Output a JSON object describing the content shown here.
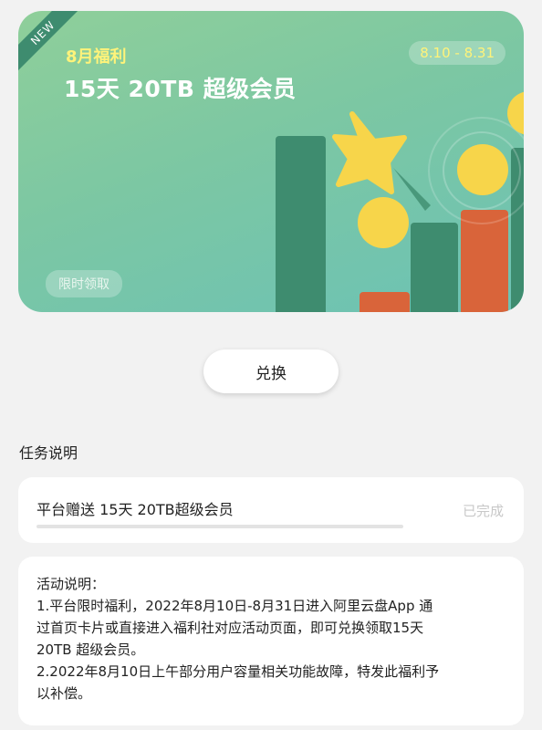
{
  "banner": {
    "ribbon_label": "NEW",
    "subtitle": "8月福利",
    "title": "15天 20TB 超级会员",
    "date_range": "8.10 - 8.31",
    "limited_label": "限时领取"
  },
  "redeem_button": {
    "label": "兑换"
  },
  "task_section": {
    "title": "任务说明",
    "task": {
      "label": "平台赠送 15天 20TB超级会员",
      "status": "已完成",
      "progress": 1.0
    }
  },
  "description": {
    "lines": [
      "活动说明：",
      "1.平台限时福利，2022年8月10日-8月31日进入阿里云盘App 通",
      "过首页卡片或直接进入福利社对应活动页面，即可兑换领取15天",
      "20TB 超级会员。",
      "2.2022年8月10日上午部分用户容量相关功能故障，特发此福利予",
      "以补偿。"
    ]
  },
  "colors": {
    "banner_gradient_start": "#8fcf9a",
    "banner_gradient_end": "#6cc2b5",
    "accent_yellow": "#fff37a",
    "bar_dark_green": "#3e8c6f",
    "bar_orange": "#d9643a",
    "coin_yellow": "#f7d54a"
  }
}
